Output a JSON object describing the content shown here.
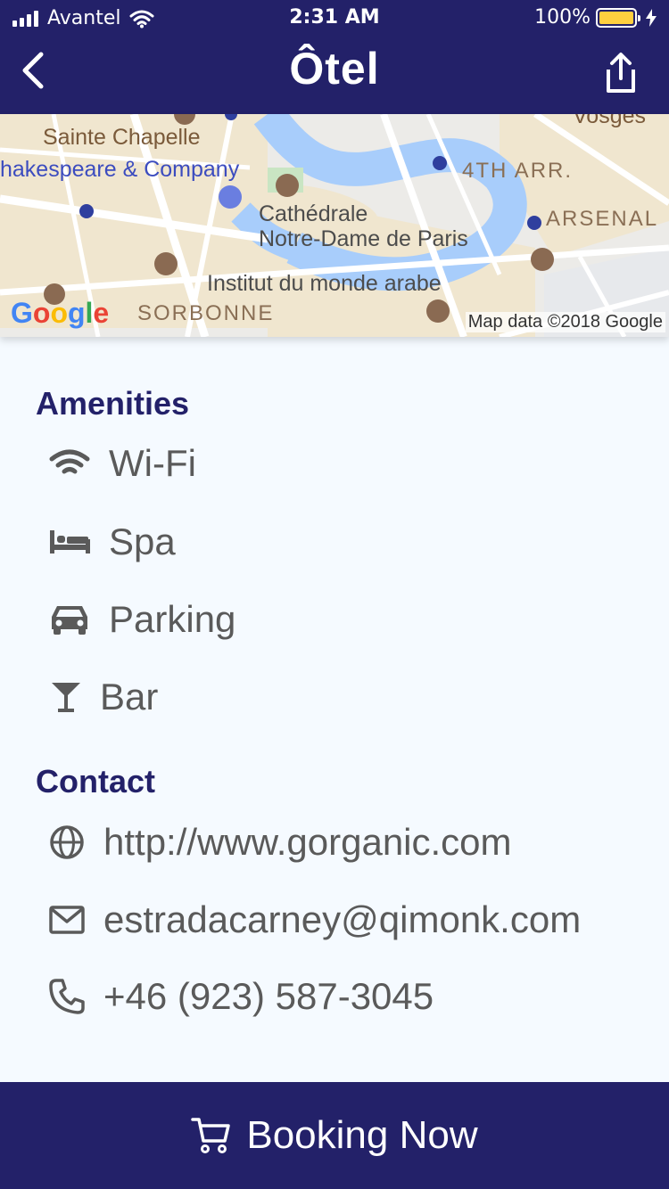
{
  "status_bar": {
    "carrier": "Avantel",
    "time": "2:31 AM",
    "battery": "100%"
  },
  "header": {
    "title": "Ôtel",
    "back_icon": "chevron-left-icon",
    "share_icon": "share-icon"
  },
  "map": {
    "labels": {
      "sainte_chapelle": "Sainte Chapelle",
      "shakespeare": "hakespeare & Company",
      "vosges": "Vosges",
      "arr4": "4TH ARR.",
      "notre_dame_1": "Cathédrale",
      "notre_dame_2": "Notre-Dame de Paris",
      "arsenal": "ARSENAL",
      "institut": "Institut du monde arabe",
      "sorbonne": "SORBONNE"
    },
    "logo": "Google",
    "credit": "Map data ©2018 Google"
  },
  "amenities": {
    "heading": "Amenities",
    "items": [
      {
        "icon": "wifi-icon",
        "label": "Wi-Fi"
      },
      {
        "icon": "bed-icon",
        "label": "Spa"
      },
      {
        "icon": "car-icon",
        "label": "Parking"
      },
      {
        "icon": "cocktail-icon",
        "label": "Bar"
      }
    ]
  },
  "contact": {
    "heading": "Contact",
    "items": [
      {
        "icon": "globe-icon",
        "label": "http://www.gorganic.com"
      },
      {
        "icon": "mail-icon",
        "label": "estradacarney@qimonk.com"
      },
      {
        "icon": "phone-icon",
        "label": "+46 (923) 587-3045"
      }
    ]
  },
  "booking": {
    "label": "Booking Now",
    "icon": "cart-icon"
  },
  "colors": {
    "brand": "#232169",
    "background": "#f5faff",
    "text": "#5a5a5a",
    "battery": "#ffcf3f"
  }
}
